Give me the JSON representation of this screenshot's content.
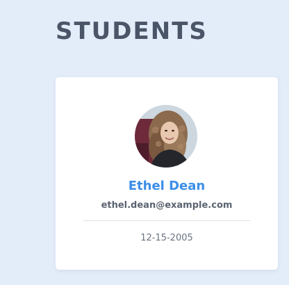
{
  "page": {
    "title": "STUDENTS"
  },
  "student": {
    "name": "Ethel Dean",
    "email": "ethel.dean@example.com",
    "date": "12-15-2005",
    "avatar_icon": "avatar-photo"
  },
  "colors": {
    "background": "#e3ecf9",
    "title": "#4a5568",
    "name_accent": "#3b8ee8",
    "card": "#ffffff"
  }
}
